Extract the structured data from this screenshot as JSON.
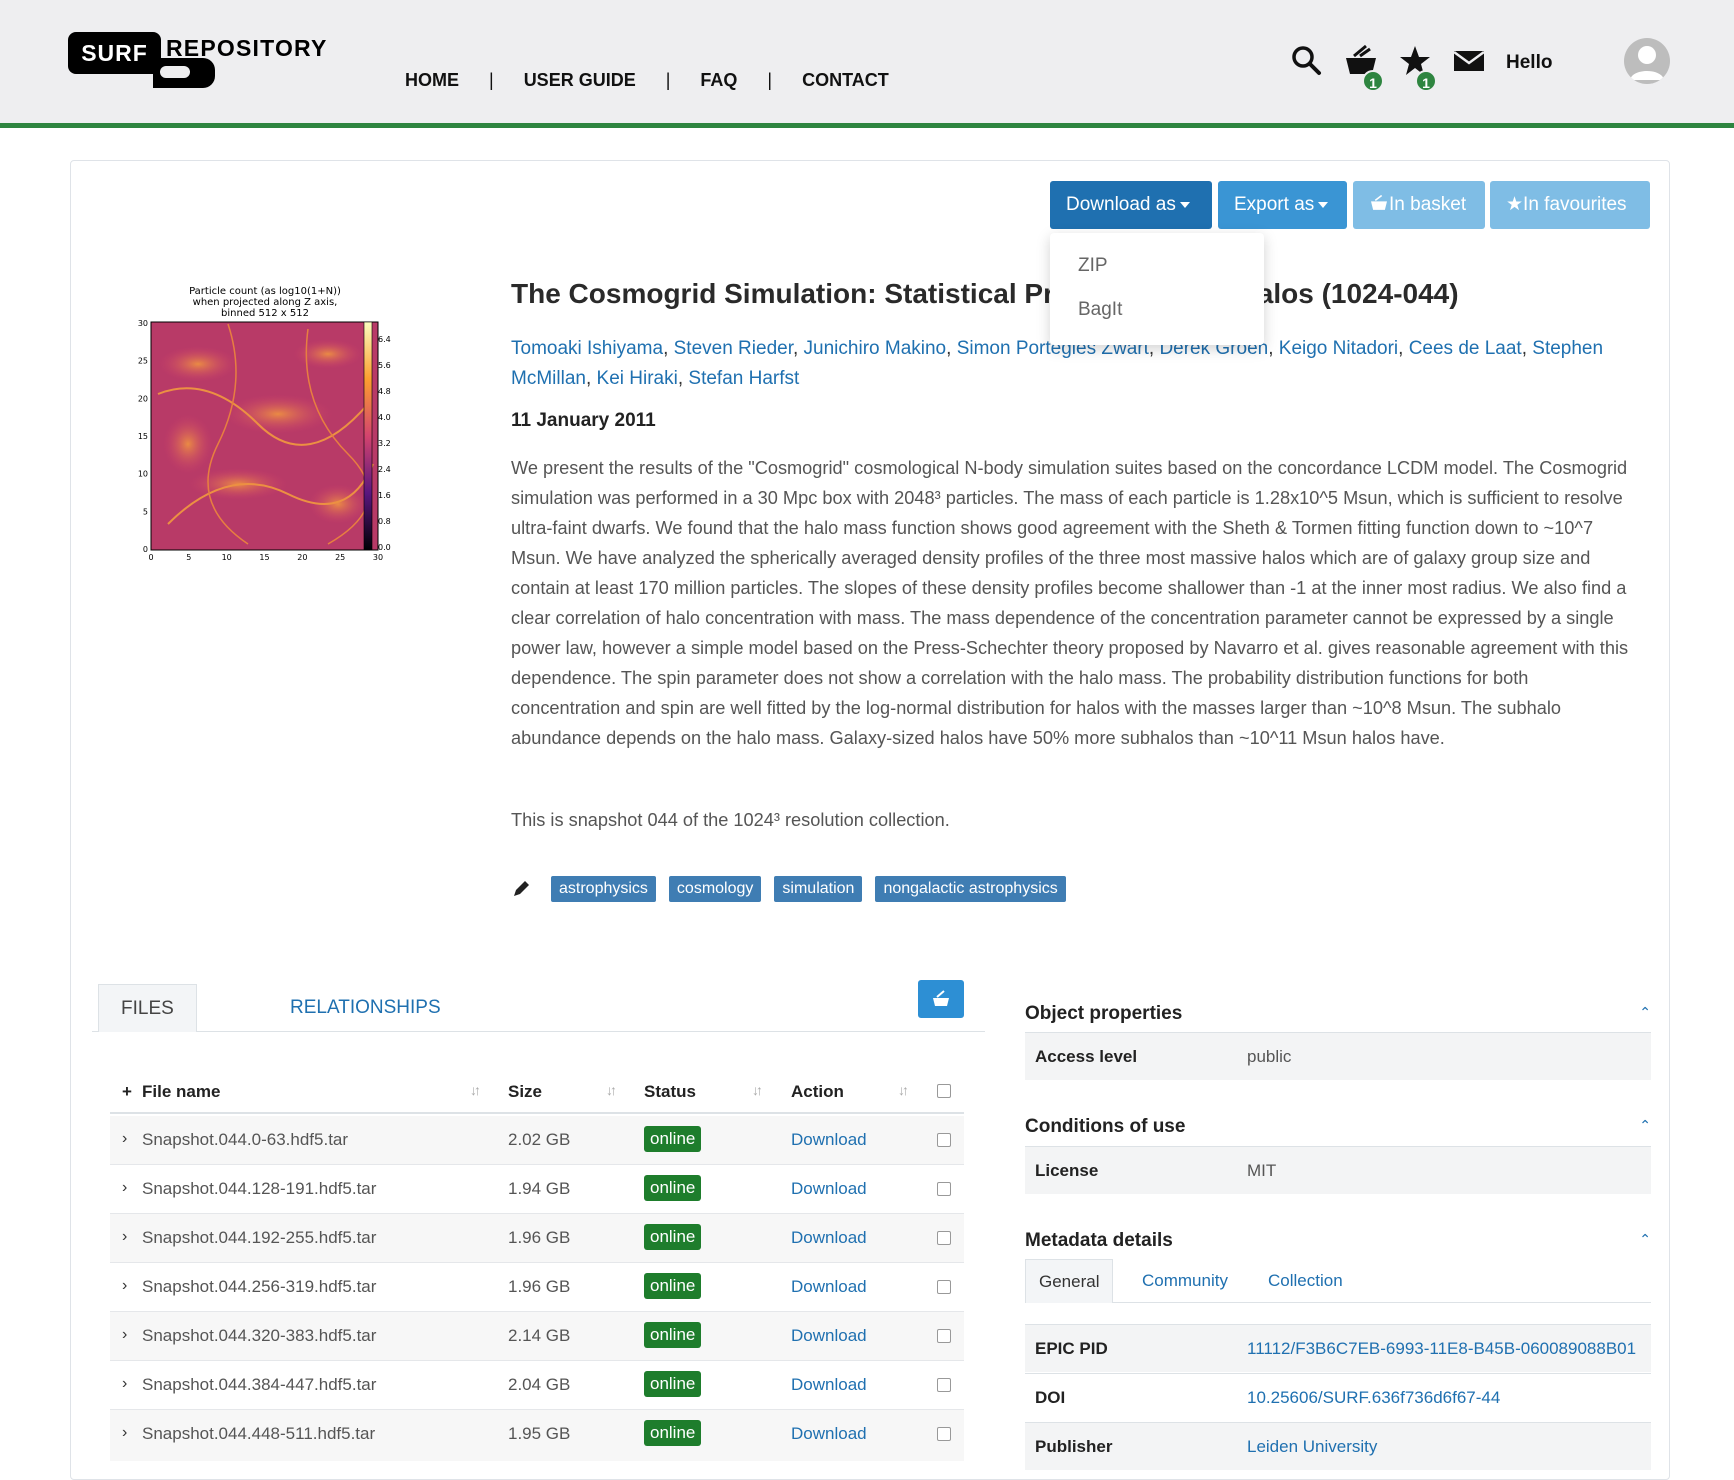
{
  "brand": {
    "left": "SURF",
    "right": "REPOSITORY"
  },
  "nav": {
    "items": [
      "HOME",
      "USER GUIDE",
      "FAQ",
      "CONTACT"
    ],
    "separator": "|"
  },
  "header": {
    "greeting": "Hello",
    "basket_count": "1",
    "favourites_count": "1"
  },
  "actions": {
    "download_as": "Download as",
    "export_as": "Export as",
    "in_basket": "In basket",
    "in_favourites": "In favourites",
    "download_options": [
      "ZIP",
      "BagIt"
    ]
  },
  "thumbnail": {
    "title_lines": [
      "Particle count (as log10(1+N))",
      "when projected along Z axis,",
      "binned 512 x 512"
    ],
    "y_ticks": [
      "30",
      "25",
      "20",
      "15",
      "10",
      "5",
      "0"
    ],
    "x_ticks": [
      "0",
      "5",
      "10",
      "15",
      "20",
      "25",
      "30"
    ],
    "colorbar_ticks": [
      "6.4",
      "5.6",
      "4.8",
      "4.0",
      "3.2",
      "2.4",
      "1.6",
      "0.8",
      "0.0"
    ]
  },
  "record": {
    "title": "The Cosmogrid Simulation: Statistical Prop                              ark Matter Halos (1024-044)",
    "authors": [
      "Tomoaki Ishiyama",
      "Steven Rieder",
      "Junichiro Makino",
      "Simon Portegies Zwart",
      "Derek Groen",
      "Keigo Nitadori",
      "Cees de Laat",
      "Stephen McMillan",
      "Kei Hiraki",
      "Stefan Harfst"
    ],
    "date": "11 January 2011",
    "abstract": "We present the results of the \"Cosmogrid\" cosmological N-body simulation suites based on the concordance LCDM model. The Cosmogrid simulation was performed in a 30 Mpc box with 2048³ particles. The mass of each particle is 1.28x10^5 Msun, which is sufficient to resolve ultra-faint dwarfs. We found that the halo mass function shows good agreement with the Sheth & Tormen fitting function down to ~10^7 Msun. We have analyzed the spherically averaged density profiles of the three most massive halos which are of galaxy group size and contain at least 170 million particles. The slopes of these density profiles become shallower than -1 at the inner most radius. We also find a clear correlation of halo concentration with mass. The mass dependence of the concentration parameter cannot be expressed by a single power law, however a simple model based on the Press-Schechter theory proposed by Navarro et al. gives reasonable agreement with this dependence. The spin parameter does not show a correlation with the halo mass. The probability distribution functions for both concentration and spin are well fitted by the log-normal distribution for halos with the masses larger than ~10^8 Msun. The subhalo abundance depends on the halo mass. Galaxy-sized halos have 50% more subhalos than ~10^11 Msun halos have.",
    "note": "This is snapshot 044 of the 1024³ resolution collection.",
    "tags": [
      "astrophysics",
      "cosmology",
      "simulation",
      "nongalactic astrophysics"
    ]
  },
  "files": {
    "tabs": [
      "FILES",
      "RELATIONSHIPS"
    ],
    "columns": {
      "expand": "+",
      "name": "File name",
      "size": "Size",
      "status": "Status",
      "action": "Action"
    },
    "rows": [
      {
        "name": "Snapshot.044.0-63.hdf5.tar",
        "size": "2.02 GB",
        "status": "online",
        "action": "Download"
      },
      {
        "name": "Snapshot.044.128-191.hdf5.tar",
        "size": "1.94 GB",
        "status": "online",
        "action": "Download"
      },
      {
        "name": "Snapshot.044.192-255.hdf5.tar",
        "size": "1.96 GB",
        "status": "online",
        "action": "Download"
      },
      {
        "name": "Snapshot.044.256-319.hdf5.tar",
        "size": "1.96 GB",
        "status": "online",
        "action": "Download"
      },
      {
        "name": "Snapshot.044.320-383.hdf5.tar",
        "size": "2.14 GB",
        "status": "online",
        "action": "Download"
      },
      {
        "name": "Snapshot.044.384-447.hdf5.tar",
        "size": "2.04 GB",
        "status": "online",
        "action": "Download"
      },
      {
        "name": "Snapshot.044.448-511.hdf5.tar",
        "size": "1.95 GB",
        "status": "online",
        "action": "Download"
      }
    ]
  },
  "properties": {
    "object_title": "Object properties",
    "access_level_label": "Access level",
    "access_level_value": "public",
    "conditions_title": "Conditions of use",
    "license_label": "License",
    "license_value": "MIT",
    "metadata_title": "Metadata details",
    "metadata_tabs": [
      "General",
      "Community",
      "Collection"
    ],
    "epic_label": "EPIC PID",
    "epic_value": "11112/F3B6C7EB-6993-11E8-B45B-060089088B01",
    "doi_label": "DOI",
    "doi_value": "10.25606/SURF.636f736d6f67-44",
    "publisher_label": "Publisher",
    "publisher_value": "Leiden University"
  },
  "colors": {
    "accent_green": "#2e8540",
    "link_blue": "#1f70b0",
    "button_blue": "#3a95d4",
    "status_green": "#1e7d2c"
  }
}
